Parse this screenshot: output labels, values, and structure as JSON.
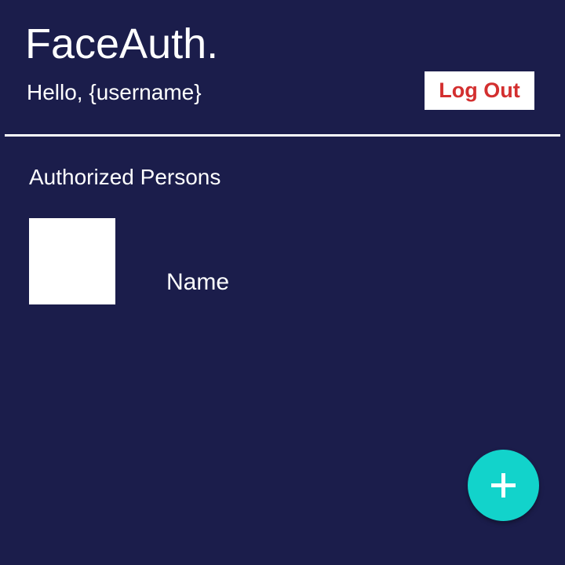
{
  "header": {
    "title": "FaceAuth.",
    "greeting": "Hello, {username}",
    "logout_label": "Log Out"
  },
  "main": {
    "section_title": "Authorized Persons",
    "persons": [
      {
        "name": "Name"
      }
    ]
  },
  "fab": {
    "icon": "plus-icon"
  },
  "colors": {
    "background": "#1b1d4b",
    "logout_text": "#d32f2f",
    "fab": "#12d3cb",
    "text": "#ffffff"
  }
}
